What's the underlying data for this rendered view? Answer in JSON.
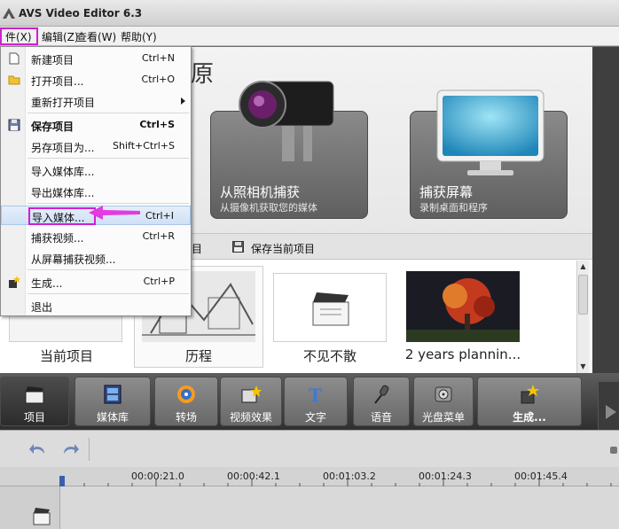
{
  "window": {
    "title": "AVS Video Editor 6.3"
  },
  "menubar": {
    "file": "件(X)",
    "edit": "编辑(Z)",
    "view": "查看(W)",
    "help": "帮助(Y)"
  },
  "hero": {
    "title_partial": "原",
    "cards": [
      {
        "title": "从照相机捕获",
        "subtitle": "从摄像机获取您的媒体",
        "icon": "camcorder-icon"
      },
      {
        "title": "捕获屏幕",
        "subtitle": "录制桌面和程序",
        "icon": "monitor-icon"
      }
    ]
  },
  "project_bar": {
    "partial_label": "目",
    "save_label": "保存当前项目"
  },
  "thumbnails": [
    {
      "label": "当前项目"
    },
    {
      "label": "历程"
    },
    {
      "label": "不见不散"
    },
    {
      "label": "2 years plannin..."
    }
  ],
  "file_menu": {
    "items": [
      {
        "label": "新建项目",
        "shortcut": "Ctrl+N",
        "icon": "new-file-icon"
      },
      {
        "label": "打开项目...",
        "shortcut": "Ctrl+O",
        "icon": "folder-icon"
      },
      {
        "label": "重新打开项目",
        "shortcut": "",
        "icon": "",
        "submenu": true
      },
      {
        "label": "保存项目",
        "shortcut": "Ctrl+S",
        "icon": "floppy-icon",
        "bold": true
      },
      {
        "label": "另存项目为...",
        "shortcut": "Shift+Ctrl+S",
        "icon": ""
      },
      {
        "label": "导入媒体库...",
        "shortcut": "",
        "icon": ""
      },
      {
        "label": "导出媒体库...",
        "shortcut": "",
        "icon": ""
      },
      {
        "label": "导入媒体...",
        "shortcut": "Ctrl+I",
        "icon": "",
        "highlighted": true
      },
      {
        "label": "捕获视频...",
        "shortcut": "Ctrl+R",
        "icon": ""
      },
      {
        "label": "从屏幕捕获视频...",
        "shortcut": "",
        "icon": ""
      },
      {
        "label": "生成...",
        "shortcut": "Ctrl+P",
        "icon": "produce-icon"
      },
      {
        "label": "退出",
        "shortcut": "",
        "icon": ""
      }
    ]
  },
  "toolbar": {
    "buttons": [
      {
        "label": "项目",
        "icon": "clapperboard-icon"
      },
      {
        "label": "媒体库",
        "icon": "film-icon"
      },
      {
        "label": "转场",
        "icon": "transition-icon"
      },
      {
        "label": "视频效果",
        "icon": "effects-icon"
      },
      {
        "label": "文字",
        "icon": "text-icon"
      },
      {
        "label": "语音",
        "icon": "microphone-icon"
      },
      {
        "label": "光盘菜单",
        "icon": "disc-menu-icon"
      },
      {
        "label": "生成...",
        "icon": "produce-icon"
      }
    ]
  },
  "timeline": {
    "ticks": [
      "00:00:21.0",
      "00:00:42.1",
      "00:01:03.2",
      "00:01:24.3",
      "00:01:45.4"
    ]
  },
  "colors": {
    "annotation": "#d01fd0",
    "toolbar_dark": "#2f2f2f",
    "card_gray": "#6f6f6f"
  }
}
